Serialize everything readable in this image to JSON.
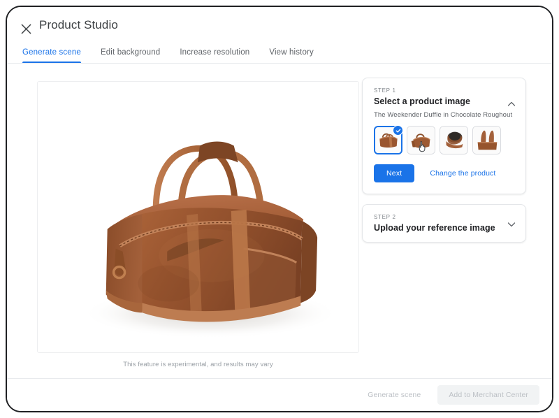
{
  "window": {
    "close_icon": "close-icon",
    "title": "Product Studio"
  },
  "tabs": [
    {
      "label": "Generate scene",
      "active": true
    },
    {
      "label": "Edit background",
      "active": false
    },
    {
      "label": "Increase resolution",
      "active": false
    },
    {
      "label": "View history",
      "active": false
    }
  ],
  "canvas": {
    "image_alt": "Brown leather weekender duffle bag on white background",
    "note": "This feature is experimental, and results may vary"
  },
  "panel": {
    "step1": {
      "eyebrow": "STEP 1",
      "heading": "Select a product image",
      "collapse_icon": "chevron-up-icon",
      "product_name": "The Weekender Duffle in Chocolate Roughout",
      "thumbnails": [
        {
          "alt": "Duffle bag three-quarter view",
          "selected": true,
          "badge_icon": "check-circle-icon",
          "cursor": false
        },
        {
          "alt": "Duffle bag side view",
          "selected": false,
          "badge_icon": "",
          "cursor": true
        },
        {
          "alt": "Duffle bag open interior view",
          "selected": false,
          "badge_icon": "",
          "cursor": false
        },
        {
          "alt": "Duffle bag handles close-up",
          "selected": false,
          "badge_icon": "",
          "cursor": false
        }
      ],
      "next_label": "Next",
      "change_product_label": "Change the product"
    },
    "step2": {
      "eyebrow": "STEP 2",
      "heading": "Upload your reference image",
      "expand_icon": "chevron-down-icon"
    }
  },
  "footer": {
    "generate_scene_label": "Generate scene",
    "add_to_merchant_center_label": "Add to Merchant Center"
  },
  "colors": {
    "accent_blue": "#1a73e8",
    "text_primary": "#202124",
    "text_secondary": "#5f6368",
    "text_muted": "#9aa0a6",
    "disabled_bg": "#f1f3f4",
    "border": "#e4e6e9",
    "frame": "#202124",
    "leather_brown": "#9b5a34"
  }
}
